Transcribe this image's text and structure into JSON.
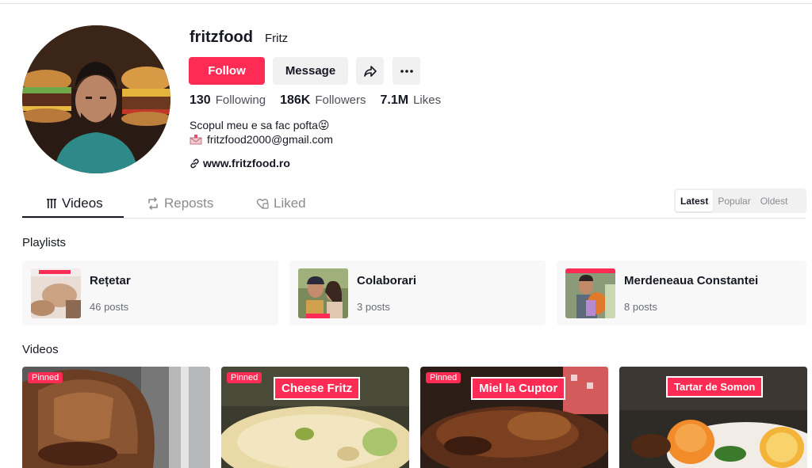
{
  "profile": {
    "username": "fritzfood",
    "nickname": "Fritz",
    "follow_label": "Follow",
    "message_label": "Message",
    "stats": [
      {
        "value": "130",
        "label": "Following"
      },
      {
        "value": "186K",
        "label": "Followers"
      },
      {
        "value": "7.1M",
        "label": "Likes"
      }
    ],
    "bio_line1": "Scopul meu e sa fac pofta😝",
    "bio_email": "fritzfood2000@gmail.com",
    "website": "www.fritzfood.ro"
  },
  "tabs": [
    {
      "label": "Videos",
      "icon": "grid-icon"
    },
    {
      "label": "Reposts",
      "icon": "repost-icon"
    },
    {
      "label": "Liked",
      "icon": "heart-icon"
    }
  ],
  "sort": [
    "Latest",
    "Popular",
    "Oldest"
  ],
  "sections": {
    "playlists_title": "Playlists",
    "videos_title": "Videos"
  },
  "playlists": [
    {
      "name": "Rețetar",
      "count": "46 posts"
    },
    {
      "name": "Colaborari",
      "count": "3 posts"
    },
    {
      "name": "Merdeneaua Constantei",
      "count": "8 posts"
    }
  ],
  "videos": [
    {
      "pinned": "Pinned",
      "label": ""
    },
    {
      "pinned": "Pinned",
      "label": "Cheese Fritz"
    },
    {
      "pinned": "Pinned",
      "label": "Miel la Cuptor"
    },
    {
      "pinned": "",
      "label": "Tartar de Somon"
    }
  ],
  "colors": {
    "accent": "#fe2c55",
    "text": "#161823",
    "secondary": "#f1f1f2"
  }
}
